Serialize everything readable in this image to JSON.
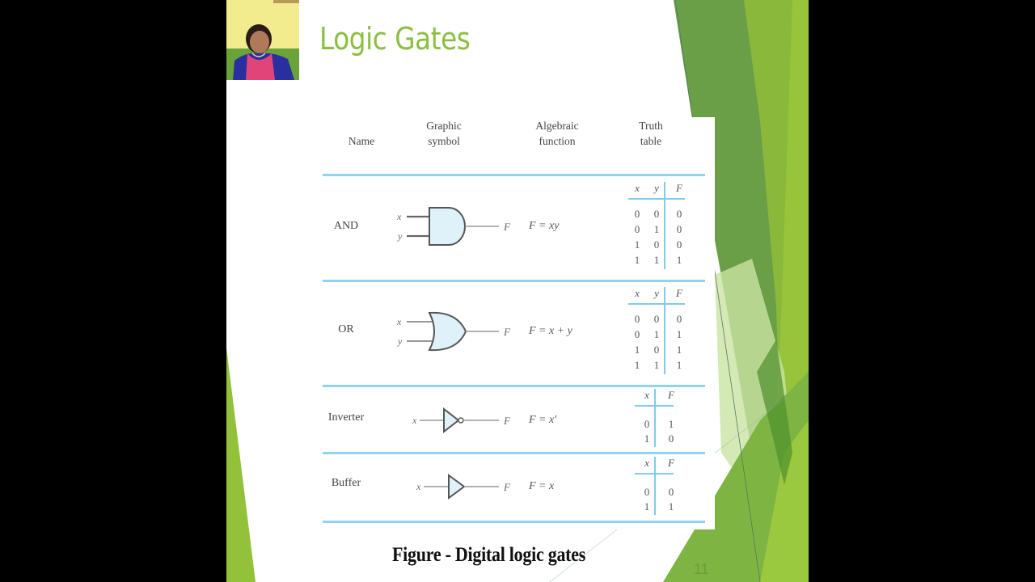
{
  "slide": {
    "title": "Logic Gates",
    "page_number": "11",
    "caption": "Figure - Digital logic gates",
    "colors": {
      "title": "#8cbf3f",
      "table_rule": "#8fd4ef",
      "gate_fill": "#dff2f9",
      "dark_green": "#5f9a3c",
      "light_green": "#93c23a",
      "pale_green": "#c9e3a3"
    }
  },
  "presenter": {
    "webcam_label": "presenter-video"
  },
  "table": {
    "headers": {
      "name": "Name",
      "symbol_line1": "Graphic",
      "symbol_line2": "symbol",
      "function_line1": "Algebraic",
      "function_line2": "function",
      "truth_line1": "Truth",
      "truth_line2": "table"
    },
    "rows": [
      {
        "name": "AND",
        "gate": "and-gate",
        "inputs": [
          "x",
          "y"
        ],
        "output": "F",
        "expression": "F = xy",
        "truth_table": {
          "columns": [
            "x",
            "y",
            "F"
          ],
          "rows": [
            [
              "0",
              "0",
              "0"
            ],
            [
              "0",
              "1",
              "0"
            ],
            [
              "1",
              "0",
              "0"
            ],
            [
              "1",
              "1",
              "1"
            ]
          ]
        }
      },
      {
        "name": "OR",
        "gate": "or-gate",
        "inputs": [
          "x",
          "y"
        ],
        "output": "F",
        "expression": "F = x + y",
        "truth_table": {
          "columns": [
            "x",
            "y",
            "F"
          ],
          "rows": [
            [
              "0",
              "0",
              "0"
            ],
            [
              "0",
              "1",
              "1"
            ],
            [
              "1",
              "0",
              "1"
            ],
            [
              "1",
              "1",
              "1"
            ]
          ]
        }
      },
      {
        "name": "Inverter",
        "gate": "not-gate",
        "inputs": [
          "x"
        ],
        "output": "F",
        "expression": "F = x'",
        "truth_table": {
          "columns": [
            "x",
            "F"
          ],
          "rows": [
            [
              "0",
              "1"
            ],
            [
              "1",
              "0"
            ]
          ]
        }
      },
      {
        "name": "Buffer",
        "gate": "buffer-gate",
        "inputs": [
          "x"
        ],
        "output": "F",
        "expression": "F = x",
        "truth_table": {
          "columns": [
            "x",
            "F"
          ],
          "rows": [
            [
              "0",
              "0"
            ],
            [
              "1",
              "1"
            ]
          ]
        }
      }
    ]
  }
}
